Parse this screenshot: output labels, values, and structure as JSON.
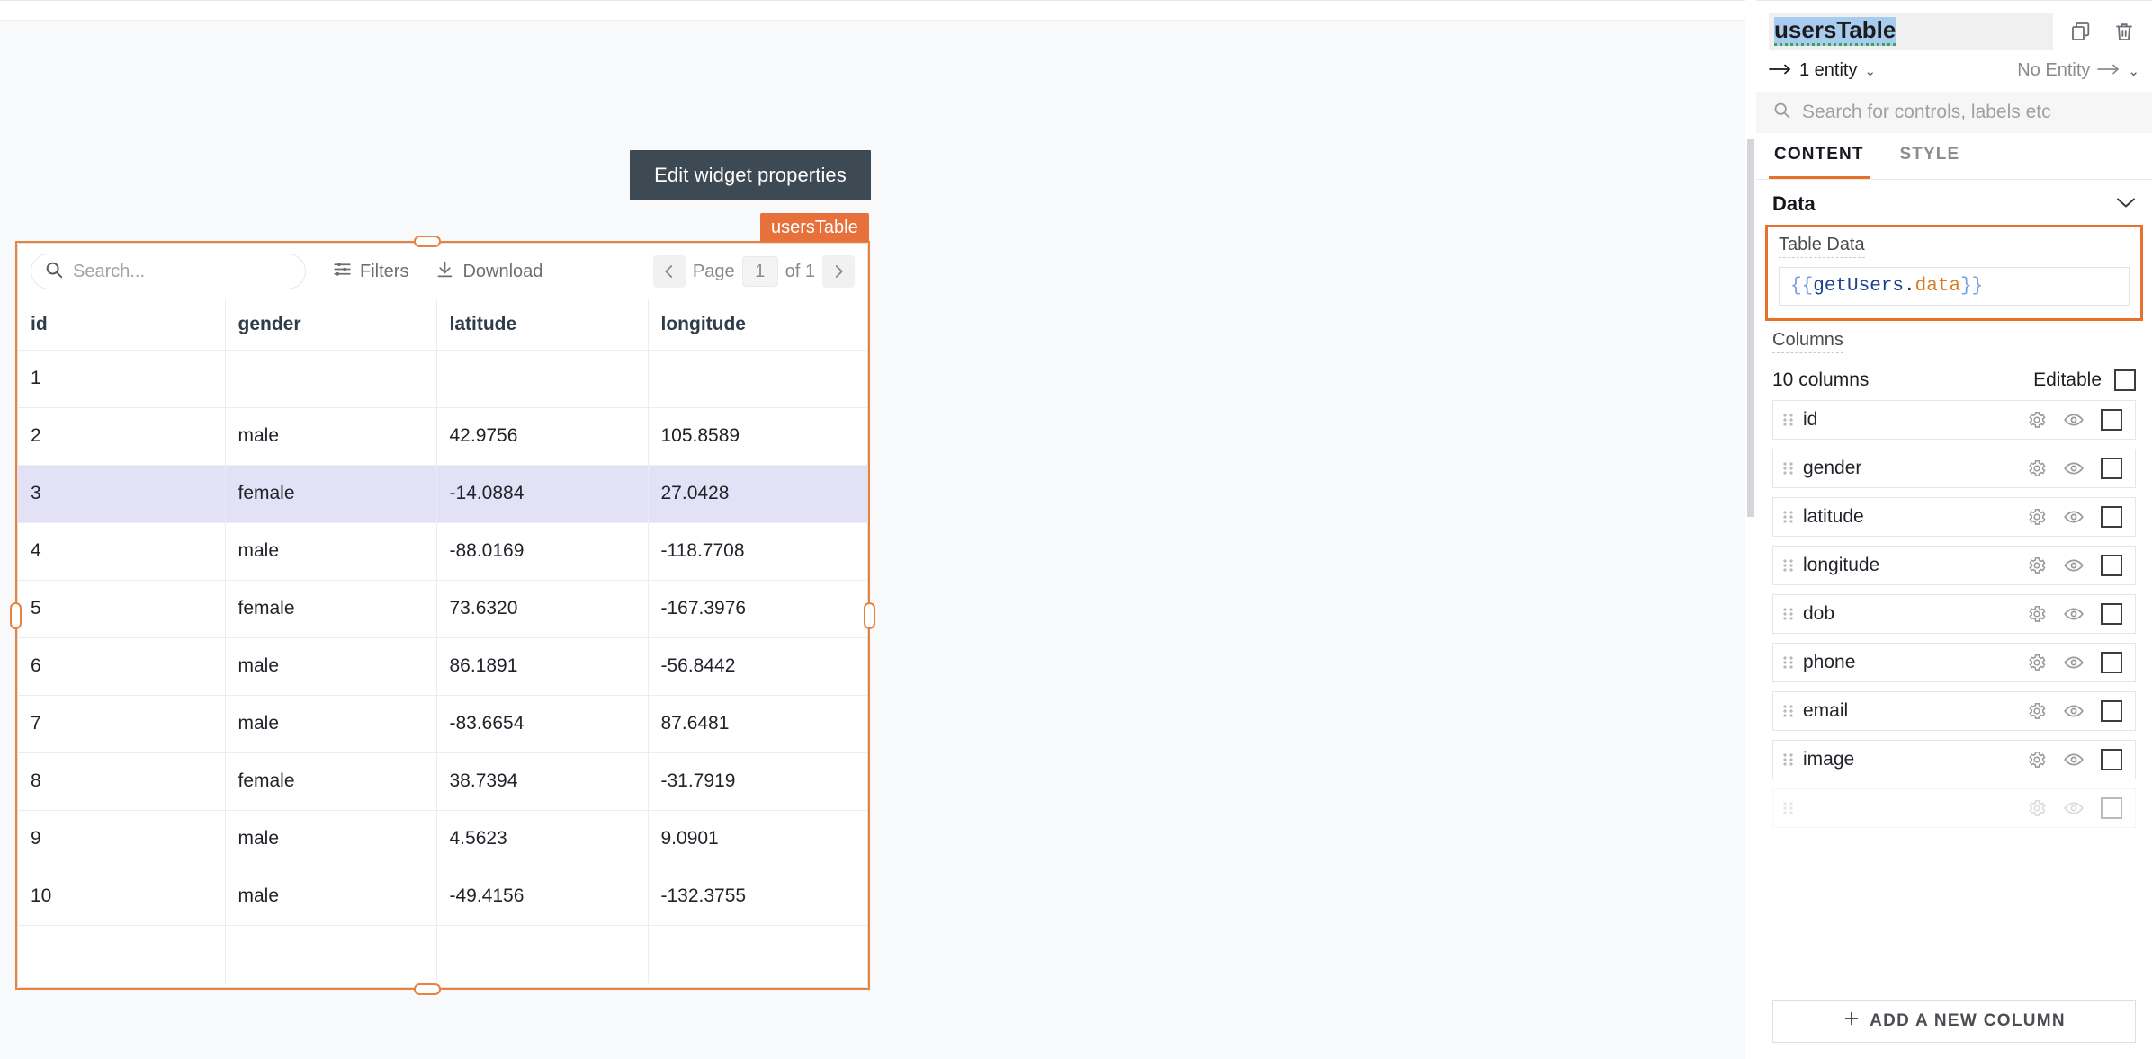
{
  "canvas": {
    "tooltip": "Edit widget properties",
    "widget_badge": "usersTable",
    "selection_color": "#e8833f"
  },
  "table_widget": {
    "search_placeholder": "Search...",
    "filters_label": "Filters",
    "download_label": "Download",
    "pagination": {
      "page_label": "Page",
      "current_page": "1",
      "of_label": "of 1",
      "prev_icon": "chevron-left-icon",
      "next_icon": "chevron-right-icon"
    },
    "columns": [
      "id",
      "gender",
      "latitude",
      "longitude"
    ],
    "rows": [
      {
        "id": "1",
        "gender": "",
        "latitude": "",
        "longitude": "",
        "selected": false
      },
      {
        "id": "2",
        "gender": "male",
        "latitude": "42.9756",
        "longitude": "105.8589",
        "selected": false
      },
      {
        "id": "3",
        "gender": "female",
        "latitude": "-14.0884",
        "longitude": "27.0428",
        "selected": true
      },
      {
        "id": "4",
        "gender": "male",
        "latitude": "-88.0169",
        "longitude": "-118.7708",
        "selected": false
      },
      {
        "id": "5",
        "gender": "female",
        "latitude": "73.6320",
        "longitude": "-167.3976",
        "selected": false
      },
      {
        "id": "6",
        "gender": "male",
        "latitude": "86.1891",
        "longitude": "-56.8442",
        "selected": false
      },
      {
        "id": "7",
        "gender": "male",
        "latitude": "-83.6654",
        "longitude": "87.6481",
        "selected": false
      },
      {
        "id": "8",
        "gender": "female",
        "latitude": "38.7394",
        "longitude": "-31.7919",
        "selected": false
      },
      {
        "id": "9",
        "gender": "male",
        "latitude": "4.5623",
        "longitude": "9.0901",
        "selected": false
      },
      {
        "id": "10",
        "gender": "male",
        "latitude": "-49.4156",
        "longitude": "-132.3755",
        "selected": false
      },
      {
        "id": "",
        "gender": "",
        "latitude": "",
        "longitude": "",
        "selected": false
      }
    ]
  },
  "panel": {
    "widget_name": "usersTable",
    "copy_icon": "copy-icon",
    "delete_icon": "trash-icon",
    "entity_left": "1 entity",
    "entity_right": "No Entity",
    "search_placeholder": "Search for controls, labels etc",
    "tabs": [
      {
        "label": "CONTENT",
        "active": true
      },
      {
        "label": "STYLE",
        "active": false
      }
    ],
    "data_section": {
      "title": "Data",
      "field_label": "Table Data",
      "code": {
        "open_brace": "{{",
        "identifier": "getUsers",
        "dot": ".",
        "property": "data",
        "close_brace": "}}"
      },
      "highlight_color": "#e8702a"
    },
    "columns_section": {
      "label": "Columns",
      "count_text": "10 columns",
      "editable_label": "Editable",
      "items": [
        {
          "name": "id"
        },
        {
          "name": "gender"
        },
        {
          "name": "latitude"
        },
        {
          "name": "longitude"
        },
        {
          "name": "dob"
        },
        {
          "name": "phone"
        },
        {
          "name": "email"
        },
        {
          "name": "image"
        },
        {
          "name": ""
        }
      ],
      "add_button": "ADD A NEW COLUMN",
      "add_icon": "plus-icon"
    }
  }
}
